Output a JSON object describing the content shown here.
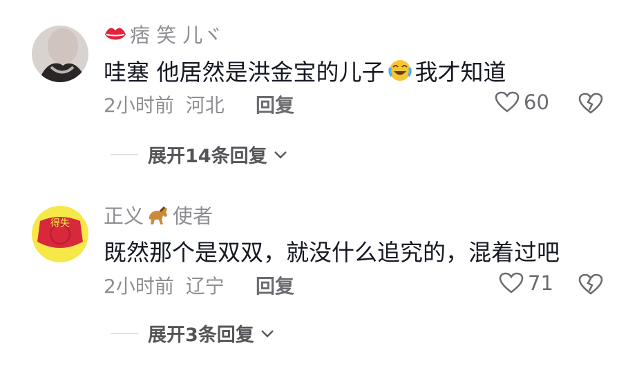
{
  "comments": [
    {
      "username": "痞 笑 儿ヾ",
      "username_badge_icon": "red-lips-icon",
      "text_before": "哇塞 他居然是洪金宝的儿子",
      "text_emoji": "laughing-crying-emoji",
      "text_after": "我才知道",
      "time": "2小时前",
      "location": "河北",
      "reply_label": "回复",
      "likes": "60",
      "expand_label": "展开14条回复"
    },
    {
      "username_before": "正义",
      "username_emoji": "horse-emoji",
      "username_after": "使者",
      "avatar_text": "得失",
      "text": "既然那个是双双，就没什么追究的，混着过吧",
      "time": "2小时前",
      "location": "辽宁",
      "reply_label": "回复",
      "likes": "71",
      "expand_label": "展开3条回复"
    }
  ],
  "colors": {
    "primary_text": "#161823",
    "secondary_text": "#8d8d92",
    "avatar_yellow": "#f7e84a",
    "avatar_red": "#d8283b"
  }
}
